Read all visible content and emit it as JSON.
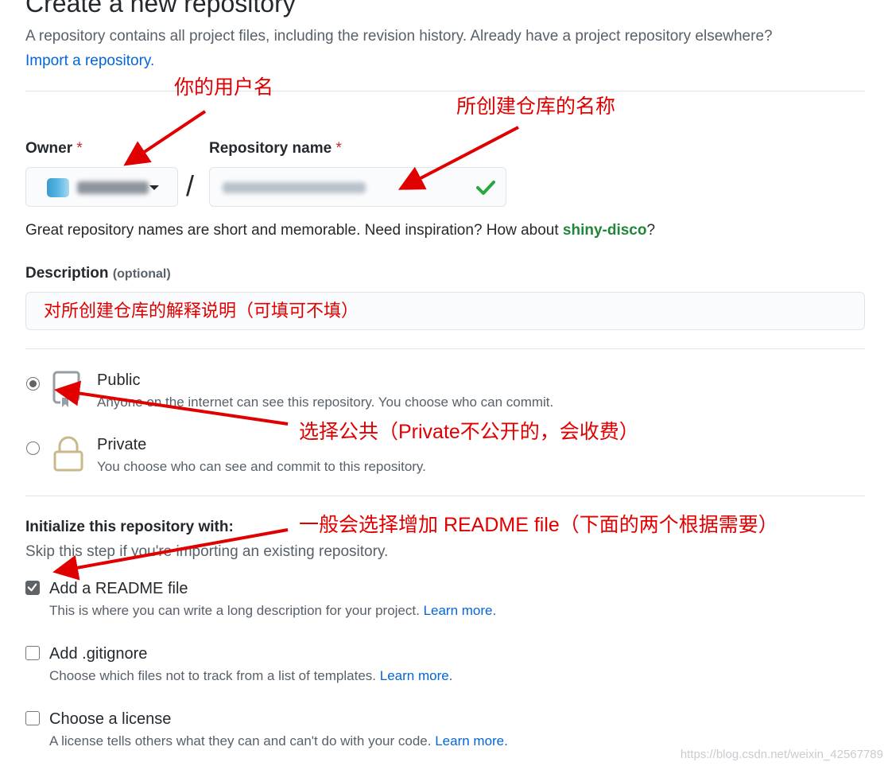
{
  "header": {
    "title": "Create a new repository",
    "description": "A repository contains all project files, including the revision history. Already have a project repository elsewhere?",
    "import_link": "Import a repository."
  },
  "owner": {
    "label": "Owner",
    "required_mark": "*"
  },
  "repo_name": {
    "label": "Repository name",
    "required_mark": "*",
    "separator": "/"
  },
  "name_hint": {
    "prefix": "Great repository names are short and memorable. Need inspiration? How about ",
    "suggestion": "shiny-disco",
    "suffix": "?"
  },
  "description": {
    "label": "Description",
    "optional": "(optional)",
    "value": "对所创建仓库的解释说明（可填可不填）"
  },
  "visibility": {
    "public": {
      "title": "Public",
      "sub": "Anyone on the internet can see this repository. You choose who can commit.",
      "selected": true
    },
    "private": {
      "title": "Private",
      "sub": "You choose who can see and commit to this repository.",
      "selected": false
    }
  },
  "initialize": {
    "title": "Initialize this repository with:",
    "sub": "Skip this step if you're importing an existing repository.",
    "readme": {
      "title": "Add a README file",
      "sub": "This is where you can write a long description for your project.",
      "link": "Learn more.",
      "checked": true
    },
    "gitignore": {
      "title": "Add .gitignore",
      "sub": "Choose which files not to track from a list of templates.",
      "link": "Learn more.",
      "checked": false
    },
    "license": {
      "title": "Choose a license",
      "sub": "A license tells others what they can and can't do with your code.",
      "link": "Learn more.",
      "checked": false
    }
  },
  "annotations": {
    "username": "你的用户名",
    "repo_name": "所创建仓库的名称",
    "public": "选择公共（Private不公开的，会收费）",
    "readme": "一般会选择增加 README file（下面的两个根据需要）",
    "color": "#e00000"
  },
  "watermark": "https://blog.csdn.net/weixin_42567789"
}
